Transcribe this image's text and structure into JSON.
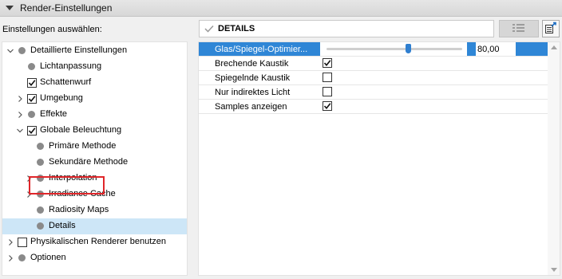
{
  "header": {
    "title": "Render-Einstellungen",
    "icon": "collapse-triangle-icon"
  },
  "left": {
    "select_label": "Einstellungen auswählen:",
    "tree": [
      {
        "label": "Detaillierte Einstellungen",
        "level": 0,
        "chevron": "down",
        "marker": "dot"
      },
      {
        "label": "Lichtanpassung",
        "level": 1,
        "chevron": "none",
        "marker": "dot"
      },
      {
        "label": "Schattenwurf",
        "level": 1,
        "chevron": "none",
        "marker": "checkbox",
        "checked": true
      },
      {
        "label": "Umgebung",
        "level": 1,
        "chevron": "right",
        "marker": "checkbox",
        "checked": true
      },
      {
        "label": "Effekte",
        "level": 1,
        "chevron": "right",
        "marker": "dot"
      },
      {
        "label": "Globale Beleuchtung",
        "level": 1,
        "chevron": "down",
        "marker": "checkbox",
        "checked": true
      },
      {
        "label": "Primäre Methode",
        "level": 2,
        "chevron": "none",
        "marker": "dot"
      },
      {
        "label": "Sekundäre Methode",
        "level": 2,
        "chevron": "none",
        "marker": "dot"
      },
      {
        "label": "Interpolation",
        "level": 2,
        "chevron": "right",
        "marker": "dot"
      },
      {
        "label": "Irradiance Cache",
        "level": 2,
        "chevron": "right",
        "marker": "dot"
      },
      {
        "label": "Radiosity Maps",
        "level": 2,
        "chevron": "none",
        "marker": "dot"
      },
      {
        "label": "Details",
        "level": 2,
        "chevron": "none",
        "marker": "dot",
        "selected": true
      },
      {
        "label": "Physikalischen Renderer benutzen",
        "level": 0,
        "chevron": "right",
        "marker": "checkbox",
        "checked": false
      },
      {
        "label": "Optionen",
        "level": 0,
        "chevron": "right",
        "marker": "dot"
      }
    ]
  },
  "right": {
    "title": "DETAILS",
    "title_icon": "checkmark-icon",
    "list_button_icon": "list-icon",
    "export_button_icon": "export-icon",
    "rows": [
      {
        "label": "Glas/Spiegel-Optimier...",
        "type": "slider",
        "value": "80,00",
        "slider_fraction": 0.6,
        "active": true
      },
      {
        "label": "Brechende Kaustik",
        "type": "checkbox",
        "checked": true
      },
      {
        "label": "Spiegelnde Kaustik",
        "type": "checkbox",
        "checked": false
      },
      {
        "label": "Nur indirektes Licht",
        "type": "checkbox",
        "checked": false
      },
      {
        "label": "Samples anzeigen",
        "type": "checkbox",
        "checked": true
      }
    ]
  },
  "colors": {
    "accent": "#2f86d6",
    "selection": "#cde6f7",
    "highlight_box": "#e0262a"
  }
}
